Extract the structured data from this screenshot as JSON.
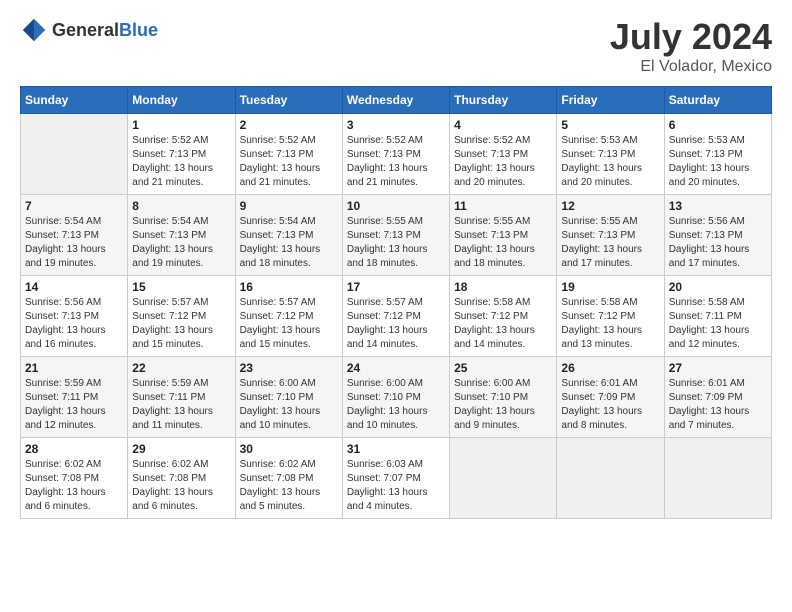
{
  "logo": {
    "general": "General",
    "blue": "Blue"
  },
  "title": {
    "month": "July 2024",
    "location": "El Volador, Mexico"
  },
  "weekdays": [
    "Sunday",
    "Monday",
    "Tuesday",
    "Wednesday",
    "Thursday",
    "Friday",
    "Saturday"
  ],
  "weeks": [
    [
      {
        "day": "",
        "empty": true
      },
      {
        "day": "1",
        "sunrise": "Sunrise: 5:52 AM",
        "sunset": "Sunset: 7:13 PM",
        "daylight": "Daylight: 13 hours and 21 minutes."
      },
      {
        "day": "2",
        "sunrise": "Sunrise: 5:52 AM",
        "sunset": "Sunset: 7:13 PM",
        "daylight": "Daylight: 13 hours and 21 minutes."
      },
      {
        "day": "3",
        "sunrise": "Sunrise: 5:52 AM",
        "sunset": "Sunset: 7:13 PM",
        "daylight": "Daylight: 13 hours and 21 minutes."
      },
      {
        "day": "4",
        "sunrise": "Sunrise: 5:52 AM",
        "sunset": "Sunset: 7:13 PM",
        "daylight": "Daylight: 13 hours and 20 minutes."
      },
      {
        "day": "5",
        "sunrise": "Sunrise: 5:53 AM",
        "sunset": "Sunset: 7:13 PM",
        "daylight": "Daylight: 13 hours and 20 minutes."
      },
      {
        "day": "6",
        "sunrise": "Sunrise: 5:53 AM",
        "sunset": "Sunset: 7:13 PM",
        "daylight": "Daylight: 13 hours and 20 minutes."
      }
    ],
    [
      {
        "day": "7",
        "sunrise": "Sunrise: 5:54 AM",
        "sunset": "Sunset: 7:13 PM",
        "daylight": "Daylight: 13 hours and 19 minutes."
      },
      {
        "day": "8",
        "sunrise": "Sunrise: 5:54 AM",
        "sunset": "Sunset: 7:13 PM",
        "daylight": "Daylight: 13 hours and 19 minutes."
      },
      {
        "day": "9",
        "sunrise": "Sunrise: 5:54 AM",
        "sunset": "Sunset: 7:13 PM",
        "daylight": "Daylight: 13 hours and 18 minutes."
      },
      {
        "day": "10",
        "sunrise": "Sunrise: 5:55 AM",
        "sunset": "Sunset: 7:13 PM",
        "daylight": "Daylight: 13 hours and 18 minutes."
      },
      {
        "day": "11",
        "sunrise": "Sunrise: 5:55 AM",
        "sunset": "Sunset: 7:13 PM",
        "daylight": "Daylight: 13 hours and 18 minutes."
      },
      {
        "day": "12",
        "sunrise": "Sunrise: 5:55 AM",
        "sunset": "Sunset: 7:13 PM",
        "daylight": "Daylight: 13 hours and 17 minutes."
      },
      {
        "day": "13",
        "sunrise": "Sunrise: 5:56 AM",
        "sunset": "Sunset: 7:13 PM",
        "daylight": "Daylight: 13 hours and 17 minutes."
      }
    ],
    [
      {
        "day": "14",
        "sunrise": "Sunrise: 5:56 AM",
        "sunset": "Sunset: 7:13 PM",
        "daylight": "Daylight: 13 hours and 16 minutes."
      },
      {
        "day": "15",
        "sunrise": "Sunrise: 5:57 AM",
        "sunset": "Sunset: 7:12 PM",
        "daylight": "Daylight: 13 hours and 15 minutes."
      },
      {
        "day": "16",
        "sunrise": "Sunrise: 5:57 AM",
        "sunset": "Sunset: 7:12 PM",
        "daylight": "Daylight: 13 hours and 15 minutes."
      },
      {
        "day": "17",
        "sunrise": "Sunrise: 5:57 AM",
        "sunset": "Sunset: 7:12 PM",
        "daylight": "Daylight: 13 hours and 14 minutes."
      },
      {
        "day": "18",
        "sunrise": "Sunrise: 5:58 AM",
        "sunset": "Sunset: 7:12 PM",
        "daylight": "Daylight: 13 hours and 14 minutes."
      },
      {
        "day": "19",
        "sunrise": "Sunrise: 5:58 AM",
        "sunset": "Sunset: 7:12 PM",
        "daylight": "Daylight: 13 hours and 13 minutes."
      },
      {
        "day": "20",
        "sunrise": "Sunrise: 5:58 AM",
        "sunset": "Sunset: 7:11 PM",
        "daylight": "Daylight: 13 hours and 12 minutes."
      }
    ],
    [
      {
        "day": "21",
        "sunrise": "Sunrise: 5:59 AM",
        "sunset": "Sunset: 7:11 PM",
        "daylight": "Daylight: 13 hours and 12 minutes."
      },
      {
        "day": "22",
        "sunrise": "Sunrise: 5:59 AM",
        "sunset": "Sunset: 7:11 PM",
        "daylight": "Daylight: 13 hours and 11 minutes."
      },
      {
        "day": "23",
        "sunrise": "Sunrise: 6:00 AM",
        "sunset": "Sunset: 7:10 PM",
        "daylight": "Daylight: 13 hours and 10 minutes."
      },
      {
        "day": "24",
        "sunrise": "Sunrise: 6:00 AM",
        "sunset": "Sunset: 7:10 PM",
        "daylight": "Daylight: 13 hours and 10 minutes."
      },
      {
        "day": "25",
        "sunrise": "Sunrise: 6:00 AM",
        "sunset": "Sunset: 7:10 PM",
        "daylight": "Daylight: 13 hours and 9 minutes."
      },
      {
        "day": "26",
        "sunrise": "Sunrise: 6:01 AM",
        "sunset": "Sunset: 7:09 PM",
        "daylight": "Daylight: 13 hours and 8 minutes."
      },
      {
        "day": "27",
        "sunrise": "Sunrise: 6:01 AM",
        "sunset": "Sunset: 7:09 PM",
        "daylight": "Daylight: 13 hours and 7 minutes."
      }
    ],
    [
      {
        "day": "28",
        "sunrise": "Sunrise: 6:02 AM",
        "sunset": "Sunset: 7:08 PM",
        "daylight": "Daylight: 13 hours and 6 minutes."
      },
      {
        "day": "29",
        "sunrise": "Sunrise: 6:02 AM",
        "sunset": "Sunset: 7:08 PM",
        "daylight": "Daylight: 13 hours and 6 minutes."
      },
      {
        "day": "30",
        "sunrise": "Sunrise: 6:02 AM",
        "sunset": "Sunset: 7:08 PM",
        "daylight": "Daylight: 13 hours and 5 minutes."
      },
      {
        "day": "31",
        "sunrise": "Sunrise: 6:03 AM",
        "sunset": "Sunset: 7:07 PM",
        "daylight": "Daylight: 13 hours and 4 minutes."
      },
      {
        "day": "",
        "empty": true
      },
      {
        "day": "",
        "empty": true
      },
      {
        "day": "",
        "empty": true
      }
    ]
  ]
}
